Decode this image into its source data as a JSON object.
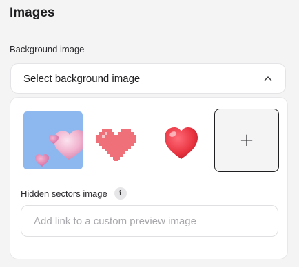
{
  "header": {
    "title": "Images"
  },
  "background": {
    "label": "Background image",
    "select_placeholder": "Select background image",
    "options": [
      {
        "name": "pink-hearts"
      },
      {
        "name": "pixel-heart"
      },
      {
        "name": "red-heart"
      }
    ]
  },
  "hidden_sectors": {
    "label": "Hidden sectors image",
    "info_glyph": "i",
    "input_placeholder": "Add link to a custom preview image",
    "input_value": ""
  },
  "upload": {
    "glyph": "+"
  },
  "colors": {
    "thumb_blue": "#8db7ef",
    "pixel_heart": "#f0707a",
    "red_heart": "#e8323f"
  }
}
